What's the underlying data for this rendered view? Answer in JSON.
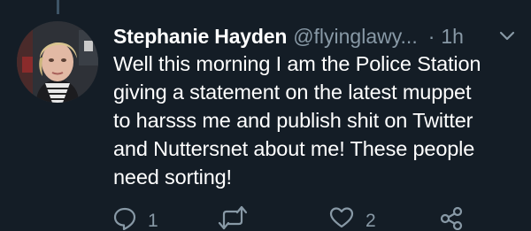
{
  "tweet": {
    "author": {
      "display_name": "Stephanie Hayden",
      "handle": "@flyinglawy..."
    },
    "separator": "·",
    "timestamp": "1h",
    "body_lines": [
      "Well this morning I am the Police Station",
      "giving a statement on the latest muppet",
      "to harsss me and publish shit on Twitter",
      "and Nuttersnet about me! These people",
      "need sorting!"
    ],
    "actions": {
      "reply_count": "1",
      "retweet_count": "",
      "like_count": "2"
    },
    "icons": {
      "reply": "reply-icon",
      "retweet": "retweet-icon",
      "like": "heart-icon",
      "share": "share-icon",
      "menu": "chevron-down-icon"
    }
  },
  "colors": {
    "background": "#141d26",
    "primary_text": "#ffffff",
    "secondary_text": "#8899a6",
    "thread_line": "#3d5466"
  }
}
